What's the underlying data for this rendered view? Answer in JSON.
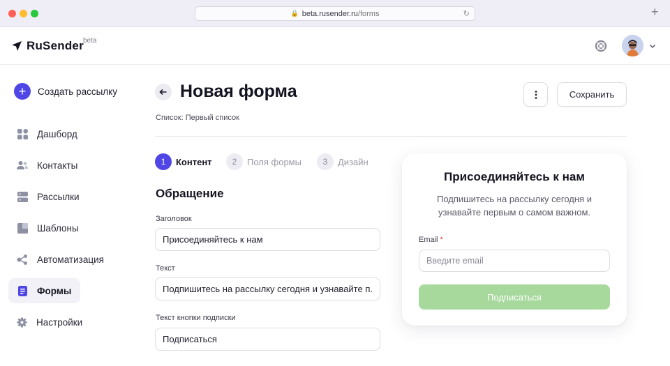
{
  "browser": {
    "url_host": "beta.rusender.ru",
    "url_path": "/forms"
  },
  "header": {
    "logo_text": "RuSender",
    "logo_badge": "beta"
  },
  "sidebar": {
    "create_label": "Создать рассылку",
    "items": [
      {
        "label": "Дашборд",
        "icon": "dashboard-icon"
      },
      {
        "label": "Контакты",
        "icon": "contacts-icon"
      },
      {
        "label": "Рассылки",
        "icon": "campaigns-icon"
      },
      {
        "label": "Шаблоны",
        "icon": "templates-icon"
      },
      {
        "label": "Автоматизация",
        "icon": "automation-icon"
      },
      {
        "label": "Формы",
        "icon": "forms-icon",
        "active": true
      },
      {
        "label": "Настройки",
        "icon": "settings-icon"
      }
    ]
  },
  "main": {
    "title": "Новая форма",
    "save_label": "Сохранить",
    "list_info": "Список: Первый список",
    "steps": [
      {
        "num": "1",
        "label": "Контент",
        "active": true
      },
      {
        "num": "2",
        "label": "Поля формы"
      },
      {
        "num": "3",
        "label": "Дизайн"
      }
    ],
    "section_title": "Обращение",
    "fields": {
      "heading_label": "Заголовок",
      "heading_value": "Присоединяйтесь к нам",
      "text_label": "Текст",
      "text_value": "Подпишитесь на рассылку сегодня и узнавайте п...",
      "button_label": "Текст кнопки подписки",
      "button_value": "Подписаться"
    }
  },
  "preview": {
    "title": "Присоединяйтесь к нам",
    "description": "Подпишитесь на рассылку сегодня и узнавайте первым о самом важном.",
    "email_label": "Email",
    "email_required_mark": "*",
    "email_placeholder": "Введите email",
    "submit_label": "Подписаться"
  },
  "colors": {
    "accent": "#4f46e5",
    "submit": "#a7d99d",
    "required": "#e23b3b"
  }
}
